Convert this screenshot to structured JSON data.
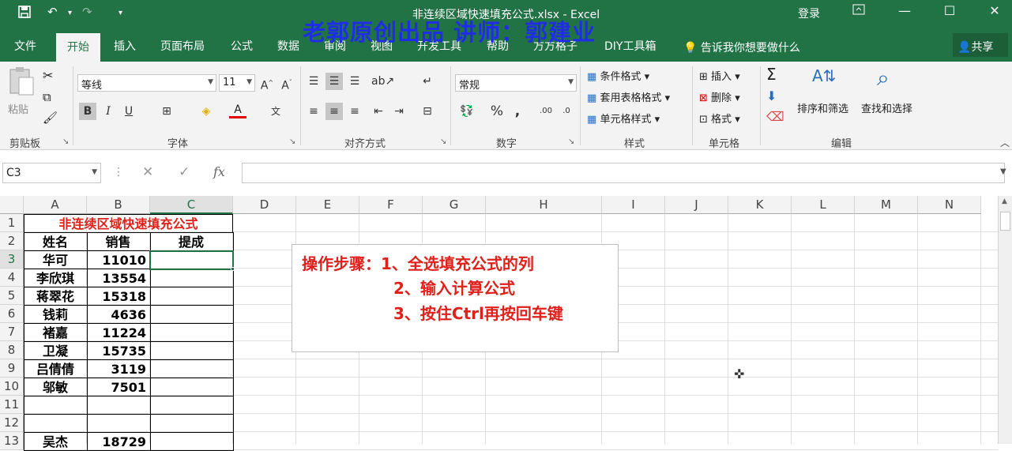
{
  "window": {
    "title": "非连续区域快速填充公式.xlsx  -  Excel",
    "login_label": "登录",
    "watermark": "老郭原创出品    讲师：郭建业"
  },
  "quick_access": {
    "undo_arrow": "▾",
    "customize": "▾"
  },
  "menu": {
    "tabs": [
      "文件",
      "开始",
      "插入",
      "页面布局",
      "公式",
      "数据",
      "审阅",
      "视图",
      "开发工具",
      "帮助",
      "方方格子",
      "DIY工具箱"
    ],
    "active_tab": "开始",
    "tell_me": "告诉我你想要做什么",
    "share": "共享"
  },
  "ribbon": {
    "clipboard": {
      "label": "剪贴板",
      "paste": "粘贴"
    },
    "font": {
      "label": "字体",
      "name": "等线",
      "size": "11",
      "bold": "B",
      "italic": "I",
      "underline": "U"
    },
    "alignment": {
      "label": "对齐方式"
    },
    "number": {
      "label": "数字",
      "format": "常规",
      "percent": "%",
      "comma": ","
    },
    "styles": {
      "label": "样式",
      "conditional": "条件格式",
      "table": "套用表格格式",
      "cell_styles": "单元格样式"
    },
    "cells": {
      "label": "单元格",
      "insert": "插入",
      "delete": "删除",
      "format": "格式"
    },
    "editing": {
      "label": "编辑",
      "sort_filter": "排序和筛选",
      "find_select": "查找和选择",
      "sigma": "Σ"
    }
  },
  "formula_bar": {
    "name_box": "C3",
    "fx": "fx",
    "value": ""
  },
  "columns": [
    "A",
    "B",
    "C",
    "D",
    "E",
    "F",
    "G",
    "H",
    "I",
    "J",
    "K",
    "L",
    "M",
    "N"
  ],
  "selected_column": "C",
  "rows": [
    "1",
    "2",
    "3",
    "4",
    "5",
    "6",
    "7",
    "8",
    "9",
    "10",
    "11",
    "12",
    "13"
  ],
  "selected_row": "3",
  "sheet": {
    "title": "非连续区域快速填充公式",
    "headers": [
      "姓名",
      "销售",
      "提成"
    ],
    "data": [
      {
        "name": "华可",
        "sales": "11010"
      },
      {
        "name": "李欣琪",
        "sales": "13554"
      },
      {
        "name": "蒋翠花",
        "sales": "15318"
      },
      {
        "name": "钱莉",
        "sales": "4636"
      },
      {
        "name": "褚嘉",
        "sales": "11224"
      },
      {
        "name": "卫凝",
        "sales": "15735"
      },
      {
        "name": "吕倩倩",
        "sales": "3119"
      },
      {
        "name": "邬敏",
        "sales": "7501"
      }
    ],
    "row13": {
      "name": "吴杰",
      "sales": "18729"
    }
  },
  "instructions": {
    "line1": "操作步骤：1、全选填充公式的列",
    "line2": "2、输入计算公式",
    "line3": "3、按住Ctrl再按回车键"
  },
  "colors": {
    "excel_green": "#217346",
    "watermark_blue": "#1f2ee6",
    "instruction_red": "#e0201a",
    "title_red": "#e0201a"
  }
}
